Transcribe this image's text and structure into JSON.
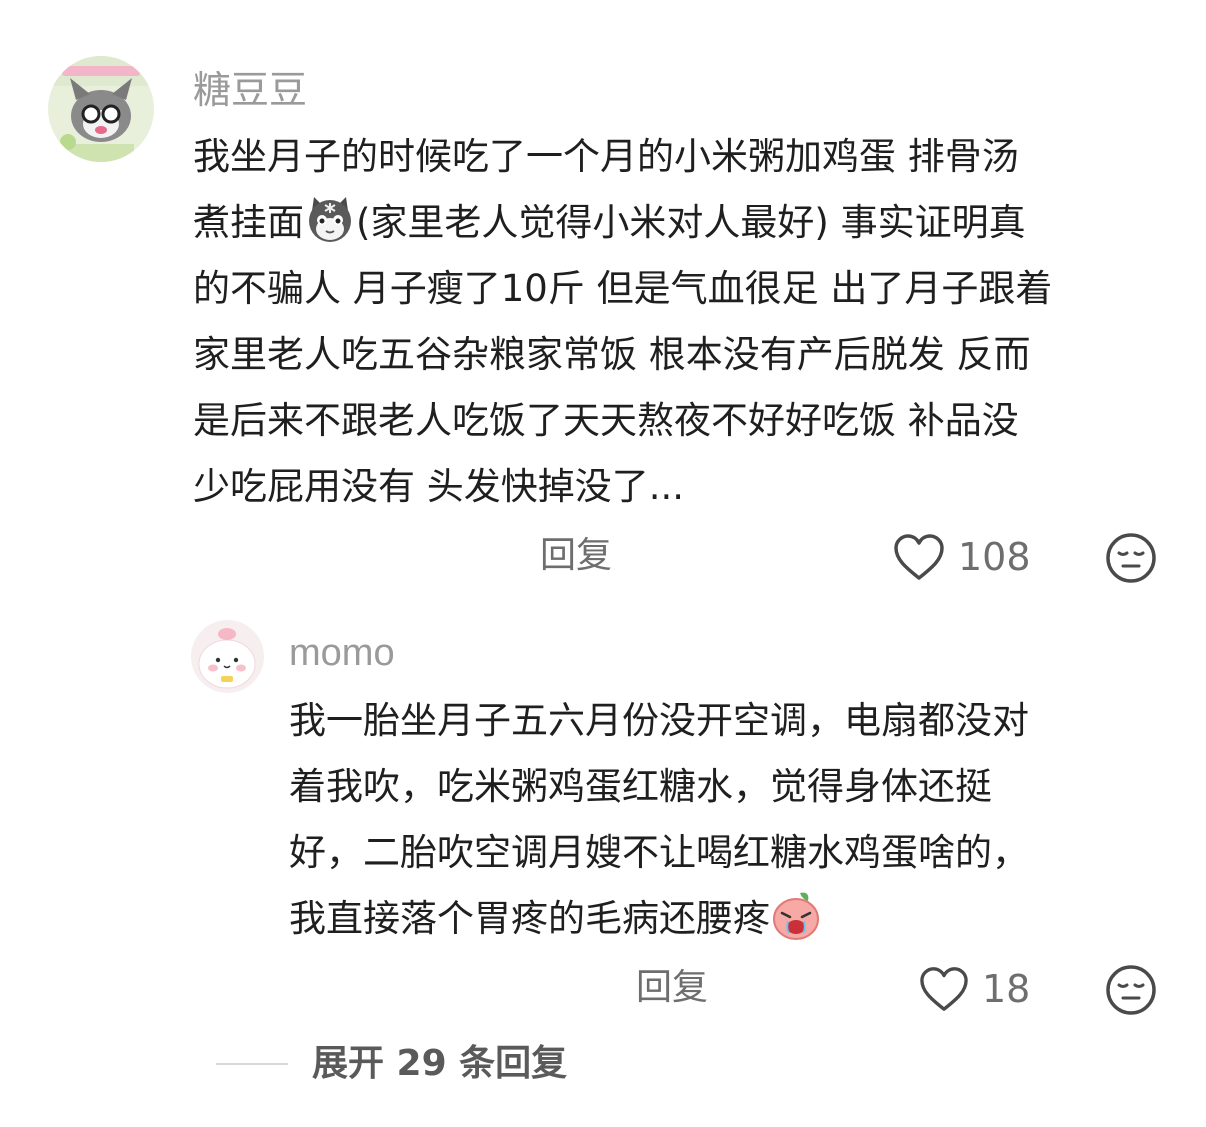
{
  "comments": [
    {
      "username": "糖豆豆",
      "lines": [
        "我坐月子的时候吃了一个月的小米粥加鸡蛋 排骨汤",
        "的不骗人 月子瘦了10斤 但是气血很足 出了月子跟着",
        "家里老人吃五谷杂粮家常饭 根本没有产后脱发 反而",
        "是后来不跟老人吃饭了天天熬夜不好好吃饭 补品没",
        "少吃屁用没有 头发快掉没了..."
      ],
      "line2_prefix": "煮挂面",
      "line2_suffix": "(家里老人觉得小米对人最好) 事实证明真",
      "reply_label": "回复",
      "like_count": "108"
    },
    {
      "username": "momo",
      "lines": [
        "我一胎坐月子五六月份没开空调，电扇都没对",
        "着我吹，吃米粥鸡蛋红糖水，觉得身体还挺",
        "好，二胎吹空调月嫂不让喝红糖水鸡蛋啥的，"
      ],
      "line4_text": "我直接落个胃疼的毛病还腰疼",
      "reply_label": "回复",
      "like_count": "18"
    }
  ],
  "expand_replies_label": "展开 29 条回复",
  "colors": {
    "username": "#9a9a9a",
    "text": "#1f1f1f",
    "action": "#6e6e6e"
  },
  "icons": {
    "like": "heart-outline-icon",
    "dislike": "neutral-face-icon",
    "emoji1": "cat-emoji",
    "emoji2": "crying-peach-emoji"
  }
}
